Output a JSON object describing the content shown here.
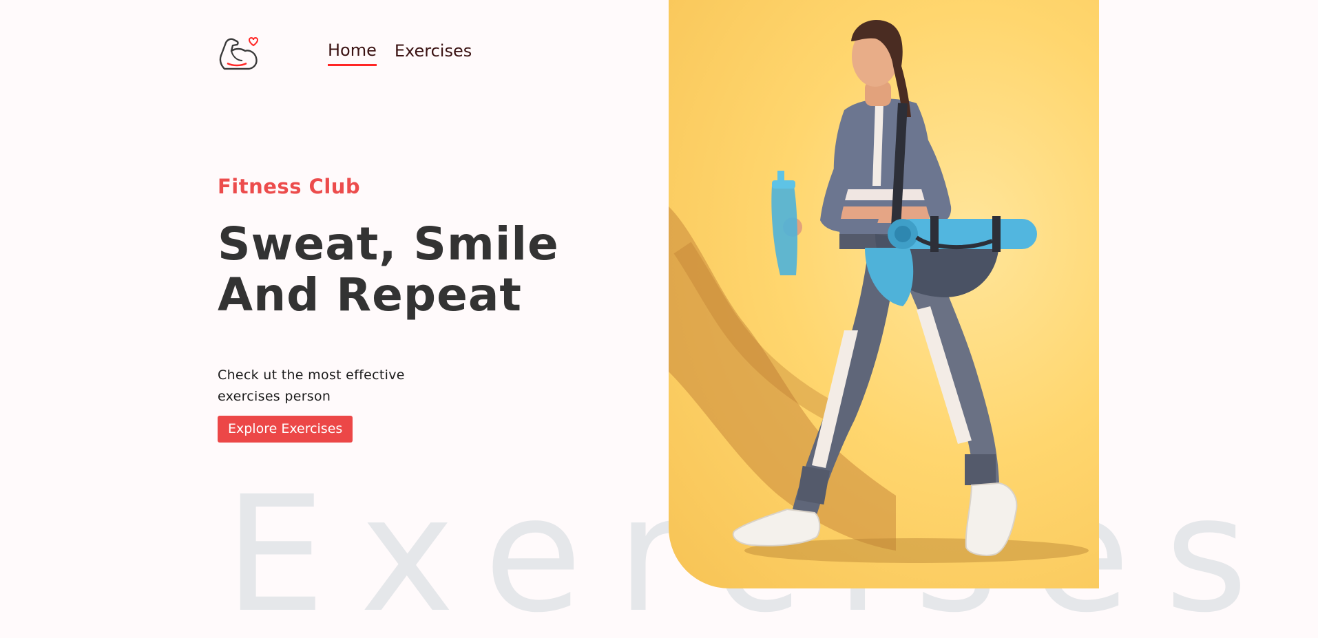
{
  "nav": {
    "logo_name": "flexed-arm-heart-icon",
    "links": [
      {
        "label": "Home",
        "active": true
      },
      {
        "label": "Exercises",
        "active": false
      }
    ]
  },
  "hero": {
    "eyebrow": "Fitness Club",
    "title_line1": "Sweat, Smile",
    "title_line2": "And Repeat",
    "description": "Check ut the most effective exercises person",
    "cta_label": "Explore Exercises"
  },
  "watermark": "Exercises",
  "colors": {
    "accent": "#ff2625",
    "button": "#ec4747",
    "eyebrow": "#ec4c4c",
    "banner_bg": "#ffd66e",
    "watermark": "#e5e7ea"
  }
}
